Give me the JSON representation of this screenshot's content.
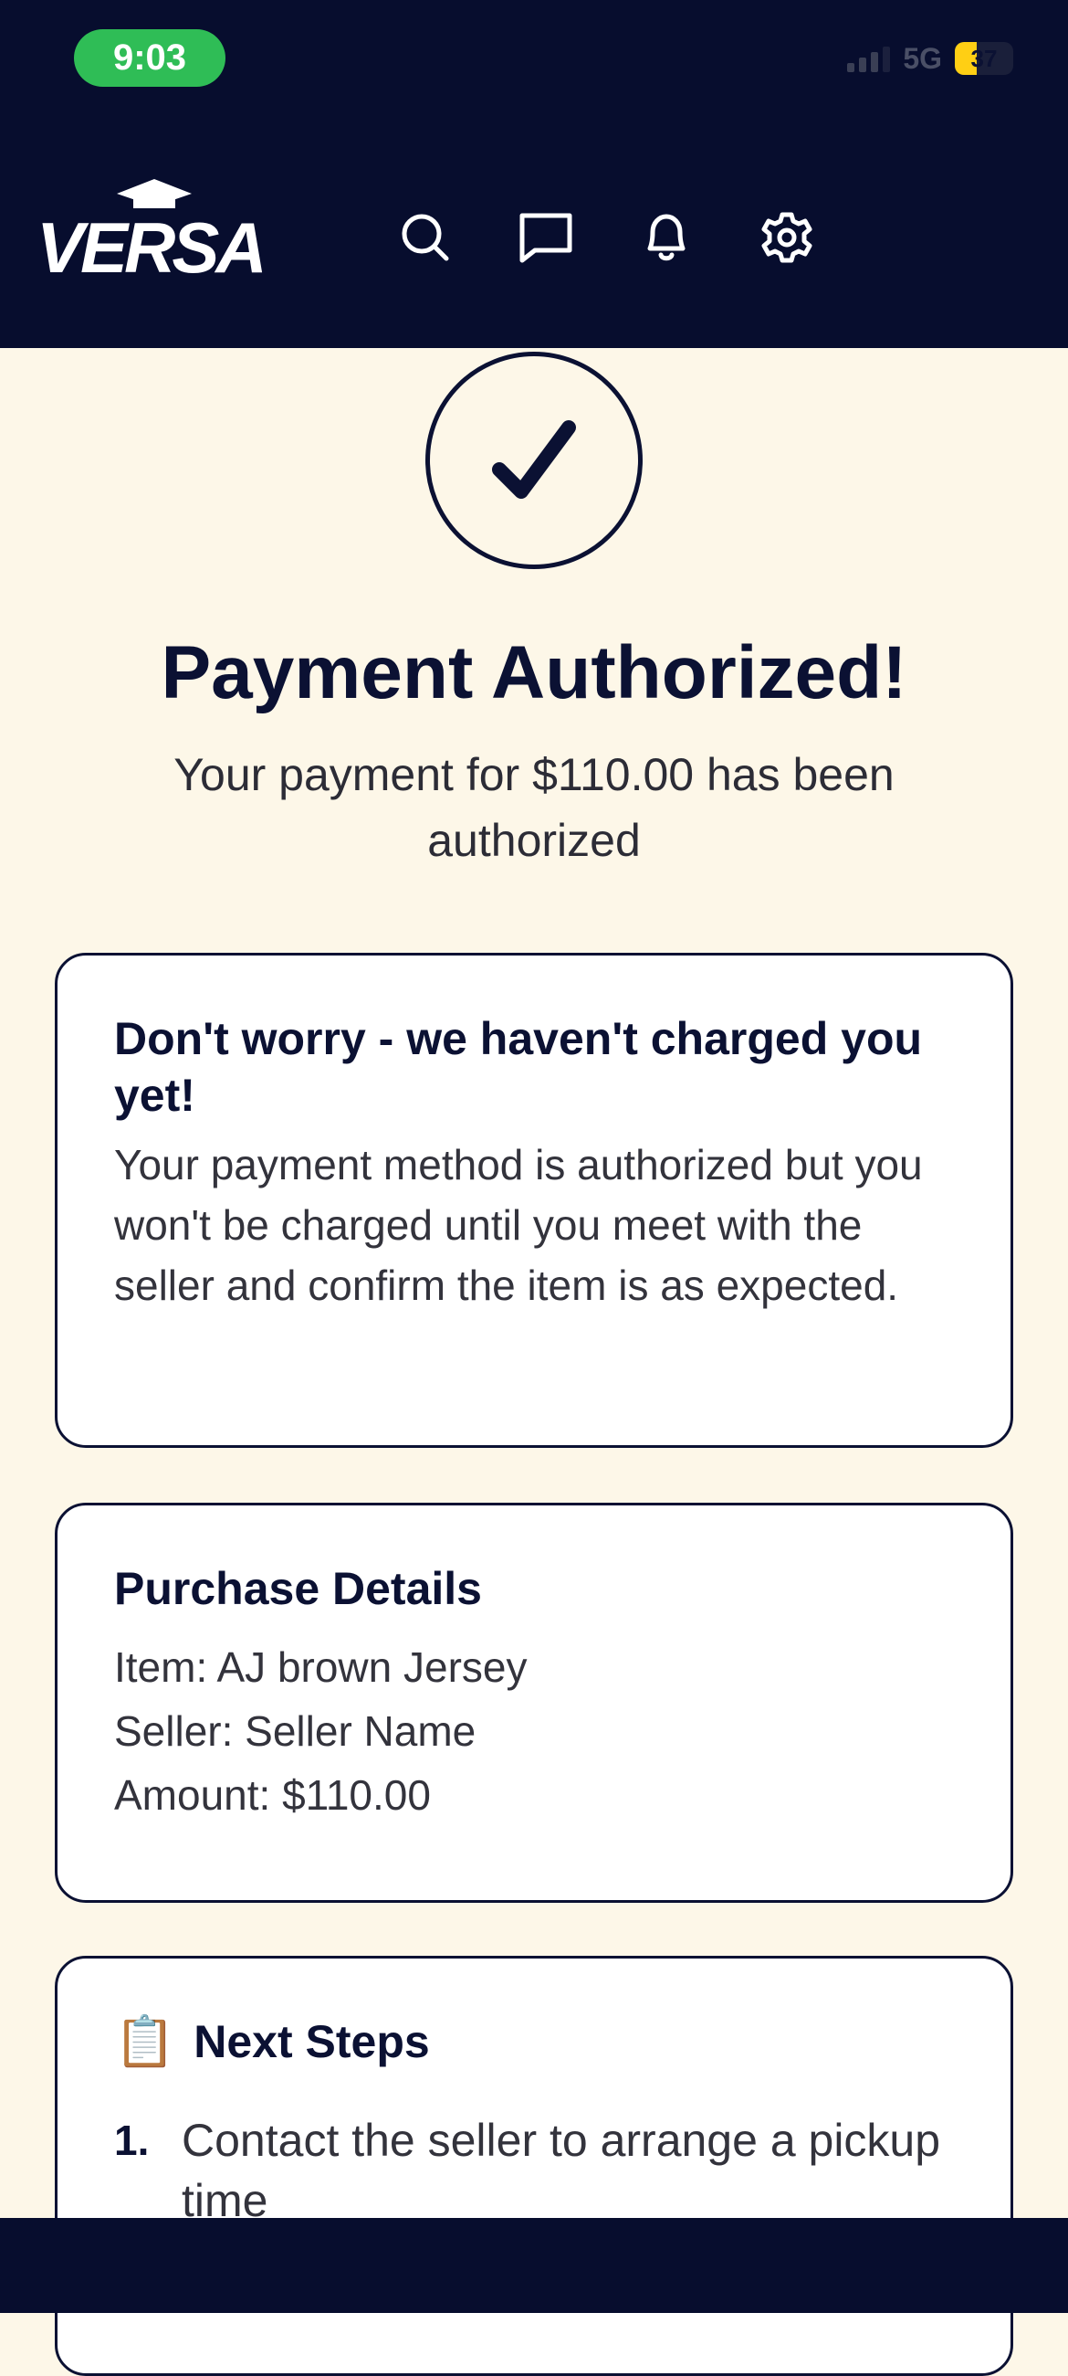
{
  "status_bar": {
    "time": "9:03",
    "network": "5G",
    "battery": "37"
  },
  "header": {
    "logo_text": "VERSA",
    "icons": [
      "search-icon",
      "chat-icon",
      "bell-icon",
      "gear-icon"
    ]
  },
  "hero": {
    "title": "Payment Authorized!",
    "subtitle": "Your payment for $110.00 has been authorized"
  },
  "notice_card": {
    "heading": "Don't worry - we haven't charged you yet!",
    "body": "Your payment method is authorized but you won't be charged until you meet with the seller and confirm the item is as expected."
  },
  "purchase_details": {
    "heading": "Purchase Details",
    "item": "Item: AJ brown Jersey",
    "seller": "Seller: Seller Name",
    "amount": "Amount: $110.00"
  },
  "next_steps": {
    "heading": "Next Steps",
    "steps": [
      {
        "number": "1.",
        "text": "Contact the seller to arrange a pickup time"
      }
    ]
  },
  "colors": {
    "navy": "#070d2e",
    "page_background": "#fdf7e8",
    "time_pill": "#2fbd56",
    "battery": "#ffcf14"
  }
}
